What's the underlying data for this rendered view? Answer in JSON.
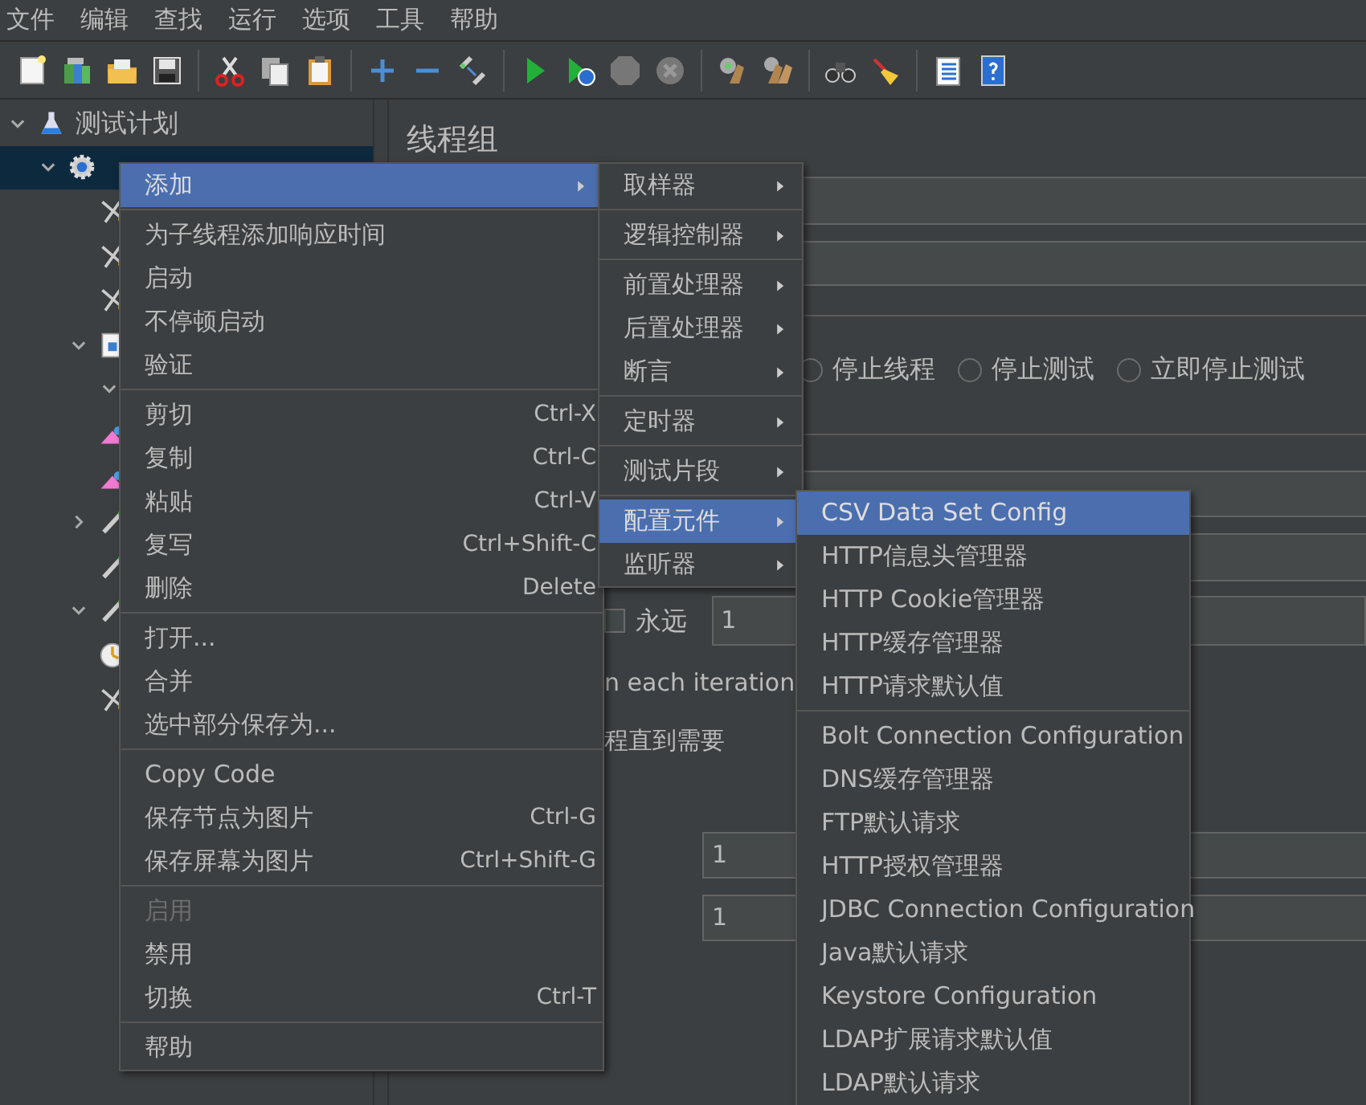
{
  "menubar": [
    "文件",
    "编辑",
    "查找",
    "运行",
    "选项",
    "工具",
    "帮助"
  ],
  "tree": [
    {
      "label": "测试计划",
      "kind": "plan",
      "expanded": true,
      "selected": false,
      "children": [
        {
          "kind": "thread_group",
          "expanded": true,
          "selected": true,
          "children": [
            {
              "kind": "sampler",
              "selected": false
            },
            {
              "kind": "sampler",
              "selected": false
            },
            {
              "kind": "sampler",
              "selected": false
            },
            {
              "kind": "table",
              "expanded": true,
              "selected": false,
              "children": [
                {
                  "expanded": true,
                  "selected": false
                }
              ]
            },
            {
              "kind": "listener",
              "selected": false
            },
            {
              "kind": "listener",
              "selected": false
            },
            {
              "kind": "processor",
              "expanded": false,
              "selected": false
            },
            {
              "kind": "processor",
              "selected": false
            },
            {
              "kind": "processor",
              "expanded": true,
              "selected": false
            },
            {
              "kind": "timer",
              "selected": false
            },
            {
              "kind": "sampler",
              "selected": false
            }
          ]
        }
      ]
    }
  ],
  "panel": {
    "title": "线程组",
    "on_error": [
      {
        "label": "停止线程",
        "selected": false
      },
      {
        "label": "停止测试",
        "selected": false
      },
      {
        "label": "立即停止测试",
        "selected": false
      }
    ],
    "loop": {
      "label": "永远",
      "checked": false,
      "value": "1"
    },
    "notes": [
      "n each iteration",
      "程直到需要"
    ],
    "fields": [
      {
        "value": "1"
      },
      {
        "value": "1"
      }
    ]
  },
  "context_menu": {
    "items": [
      {
        "kind": "item",
        "label": "添加",
        "submenu": true,
        "selected": true,
        "disabled": false
      },
      {
        "kind": "separator"
      },
      {
        "kind": "item",
        "label": "为子线程添加响应时间",
        "selected": false,
        "disabled": false
      },
      {
        "kind": "item",
        "label": "启动",
        "selected": false,
        "disabled": false
      },
      {
        "kind": "item",
        "label": "不停顿启动",
        "selected": false,
        "disabled": false
      },
      {
        "kind": "item",
        "label": "验证",
        "selected": false,
        "disabled": false
      },
      {
        "kind": "separator"
      },
      {
        "kind": "item",
        "label": "剪切",
        "shortcut": "Ctrl-X",
        "selected": false,
        "disabled": false
      },
      {
        "kind": "item",
        "label": "复制",
        "shortcut": "Ctrl-C",
        "selected": false,
        "disabled": false
      },
      {
        "kind": "item",
        "label": "粘贴",
        "shortcut": "Ctrl-V",
        "selected": false,
        "disabled": false
      },
      {
        "kind": "item",
        "label": "复写",
        "shortcut": "Ctrl+Shift-C",
        "selected": false,
        "disabled": false
      },
      {
        "kind": "item",
        "label": "删除",
        "shortcut": "Delete",
        "selected": false,
        "disabled": false
      },
      {
        "kind": "separator"
      },
      {
        "kind": "item",
        "label": "打开...",
        "selected": false,
        "disabled": false
      },
      {
        "kind": "item",
        "label": "合并",
        "selected": false,
        "disabled": false
      },
      {
        "kind": "item",
        "label": "选中部分保存为...",
        "selected": false,
        "disabled": false
      },
      {
        "kind": "separator"
      },
      {
        "kind": "item",
        "label": "Copy Code",
        "selected": false,
        "disabled": false
      },
      {
        "kind": "item",
        "label": "保存节点为图片",
        "shortcut": "Ctrl-G",
        "selected": false,
        "disabled": false
      },
      {
        "kind": "item",
        "label": "保存屏幕为图片",
        "shortcut": "Ctrl+Shift-G",
        "selected": false,
        "disabled": false
      },
      {
        "kind": "separator"
      },
      {
        "kind": "item",
        "label": "启用",
        "selected": false,
        "disabled": true
      },
      {
        "kind": "item",
        "label": "禁用",
        "selected": false,
        "disabled": false
      },
      {
        "kind": "item",
        "label": "切换",
        "shortcut": "Ctrl-T",
        "selected": false,
        "disabled": false
      },
      {
        "kind": "separator"
      },
      {
        "kind": "item",
        "label": "帮助",
        "selected": false,
        "disabled": false
      }
    ]
  },
  "add_submenu": {
    "items": [
      {
        "kind": "item",
        "label": "取样器",
        "submenu": true,
        "selected": false
      },
      {
        "kind": "separator"
      },
      {
        "kind": "item",
        "label": "逻辑控制器",
        "submenu": true,
        "selected": false
      },
      {
        "kind": "separator"
      },
      {
        "kind": "item",
        "label": "前置处理器",
        "submenu": true,
        "selected": false
      },
      {
        "kind": "item",
        "label": "后置处理器",
        "submenu": true,
        "selected": false
      },
      {
        "kind": "item",
        "label": "断言",
        "submenu": true,
        "selected": false
      },
      {
        "kind": "separator"
      },
      {
        "kind": "item",
        "label": "定时器",
        "submenu": true,
        "selected": false
      },
      {
        "kind": "separator"
      },
      {
        "kind": "item",
        "label": "测试片段",
        "submenu": true,
        "selected": false
      },
      {
        "kind": "separator"
      },
      {
        "kind": "item",
        "label": "配置元件",
        "submenu": true,
        "selected": true
      },
      {
        "kind": "item",
        "label": "监听器",
        "submenu": true,
        "selected": false
      }
    ]
  },
  "config_submenu": {
    "items": [
      {
        "kind": "item",
        "label": "CSV Data Set Config",
        "selected": true
      },
      {
        "kind": "item",
        "label": "HTTP信息头管理器",
        "selected": false
      },
      {
        "kind": "item",
        "label": "HTTP Cookie管理器",
        "selected": false
      },
      {
        "kind": "item",
        "label": "HTTP缓存管理器",
        "selected": false
      },
      {
        "kind": "item",
        "label": "HTTP请求默认值",
        "selected": false
      },
      {
        "kind": "separator"
      },
      {
        "kind": "item",
        "label": "Bolt Connection Configuration",
        "selected": false
      },
      {
        "kind": "item",
        "label": "DNS缓存管理器",
        "selected": false
      },
      {
        "kind": "item",
        "label": "FTP默认请求",
        "selected": false
      },
      {
        "kind": "item",
        "label": "HTTP授权管理器",
        "selected": false
      },
      {
        "kind": "item",
        "label": "JDBC Connection Configuration",
        "selected": false
      },
      {
        "kind": "item",
        "label": "Java默认请求",
        "selected": false
      },
      {
        "kind": "item",
        "label": "Keystore Configuration",
        "selected": false
      },
      {
        "kind": "item",
        "label": "LDAP扩展请求默认值",
        "selected": false
      },
      {
        "kind": "item",
        "label": "LDAP默认请求",
        "selected": false
      }
    ]
  }
}
